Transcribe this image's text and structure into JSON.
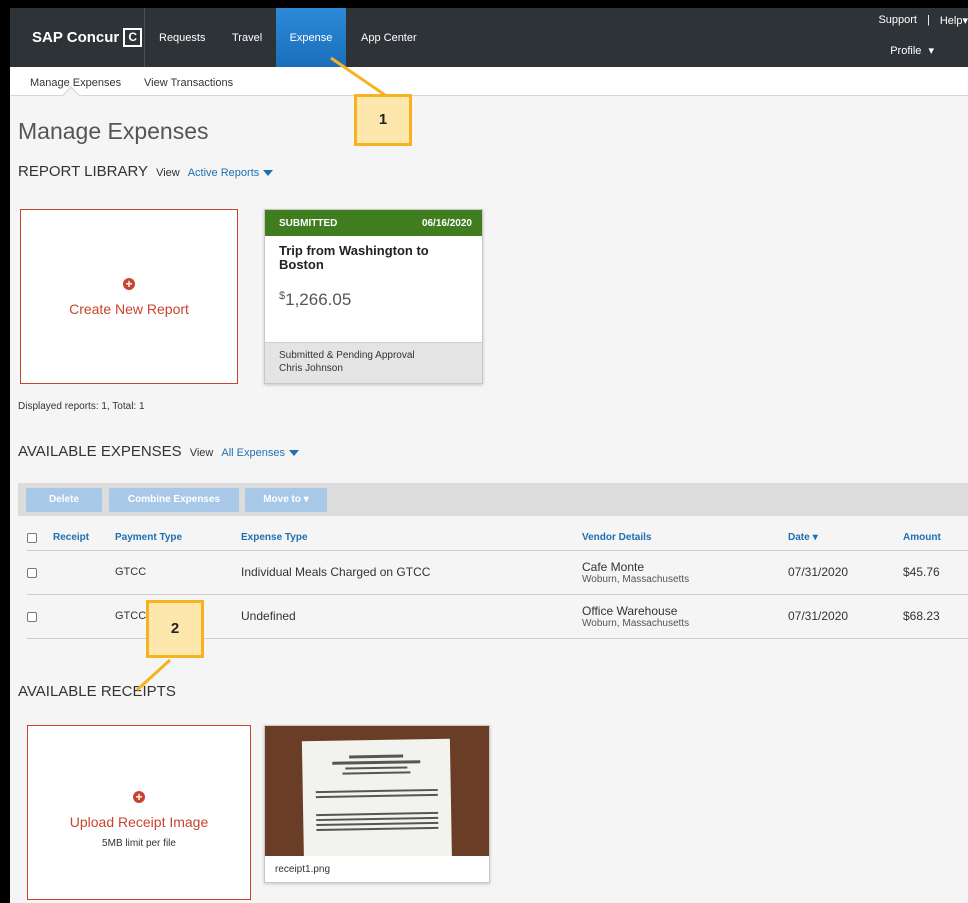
{
  "nav": {
    "logo": "SAP Concur",
    "logo_mark": "C",
    "items": [
      "Requests",
      "Travel",
      "Expense",
      "App Center"
    ],
    "support": "Support",
    "separator": "|",
    "help": "Help",
    "profile": "Profile"
  },
  "subnav": {
    "items": [
      "Manage Expenses",
      "View Transactions"
    ]
  },
  "page_title": "Manage Expenses",
  "report_library": {
    "title": "REPORT LIBRARY",
    "view_label": "View",
    "view_value": "Active Reports",
    "create_label": "Create New Report",
    "report": {
      "status": "SUBMITTED",
      "date": "06/16/2020",
      "title": "Trip from Washington to Boston",
      "currency": "$",
      "amount": "1,266.05",
      "footer_status": "Submitted & Pending Approval",
      "footer_name": "Chris Johnson"
    },
    "displayed": "Displayed reports: 1, Total: 1"
  },
  "available_expenses": {
    "title": "AVAILABLE EXPENSES",
    "view_label": "View",
    "view_value": "All Expenses",
    "toolbar": [
      "Delete",
      "Combine Expenses",
      "Move to"
    ],
    "columns": [
      "Receipt",
      "Payment Type",
      "Expense Type",
      "Vendor Details",
      "Date",
      "Amount"
    ],
    "rows": [
      {
        "payment": "GTCC",
        "type": "Individual Meals Charged on GTCC",
        "vendor": "Cafe Monte",
        "location": "Woburn, Massachusetts",
        "date": "07/31/2020",
        "amount": "$45.76"
      },
      {
        "payment": "GTCC",
        "type": "Undefined",
        "vendor": "Office Warehouse",
        "location": "Woburn, Massachusetts",
        "date": "07/31/2020",
        "amount": "$68.23"
      }
    ]
  },
  "available_receipts": {
    "title": "AVAILABLE RECEIPTS",
    "upload_label": "Upload Receipt Image",
    "upload_limit": "5MB limit per file",
    "receipt_name": "receipt1.png"
  },
  "callouts": [
    "1",
    "2"
  ],
  "colors": {
    "nav_bg": "#2e3338",
    "active_tab": "#1f7ac8",
    "submitted": "#3f7d1e",
    "accent_red": "#c9442e",
    "link_blue": "#1f6fb2",
    "callout_border": "#f5b324",
    "callout_fill": "#fde7ad"
  }
}
